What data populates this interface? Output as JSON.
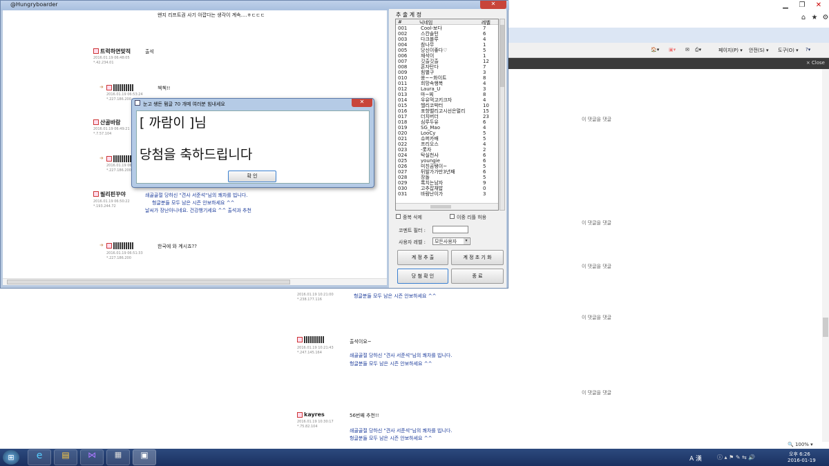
{
  "app": {
    "title": "@Hungryboarder",
    "close_label": "✕"
  },
  "content": {
    "top_text": "왠지 리프트권 사기 아깝다는 생각이 계속....ㅎㄷㄷㄷ",
    "comments": [
      {
        "user": "트럭하면맞적",
        "meta1": "2016.01.19 06:48:05",
        "meta2": "*.42.234.01",
        "text": "출석"
      },
      {
        "user": "",
        "meta1": "2016.01.19 06:53:24",
        "meta2": "*.227.186.200",
        "text": "첵첵!!"
      },
      {
        "user": "산골바람",
        "meta1": "2016.01.19 06:49:21",
        "meta2": "*.7.57.104",
        "text": ""
      },
      {
        "user": "",
        "meta1": "2016.01.19 06:",
        "meta2": "*.227.186.200",
        "text": ""
      },
      {
        "user": "필리핀꾸야",
        "meta1": "2016.01.19 06:50:22",
        "meta2": "*.193.244.72",
        "text": "쇄골골절 당하신 \"견사 서준석\"님의 쾌차를 빕니다.",
        "text2": "헝글분들 모두 남은 시즌 안보하세요 ^^",
        "text3": "날씨가 장난아니네요. 건강챙기세요  ^^ 출석과 추천"
      },
      {
        "user": "",
        "meta1": "2016.01.19 06:51:33",
        "meta2": "*.227.186.200",
        "text": "한국에 와 계시죠??"
      }
    ]
  },
  "panel": {
    "title": "추 출 계 정",
    "headers": [
      "#",
      "닉네임",
      "레벨"
    ],
    "rows": [
      [
        "001",
        "Cool-보다",
        "7"
      ],
      [
        "002",
        "스칸솔턴",
        "6"
      ],
      [
        "003",
        "다크블루",
        "4"
      ],
      [
        "004",
        "참나무",
        "1"
      ],
      [
        "005",
        "당신이좋다♡",
        "5"
      ],
      [
        "006",
        "재석이",
        "1"
      ],
      [
        "007",
        "깃츨깃츨",
        "12"
      ],
      [
        "008",
        "혼자탄다",
        "7"
      ],
      [
        "009",
        "힘별구",
        "3"
      ],
      [
        "010",
        "쏭~~화이트",
        "8"
      ],
      [
        "011",
        "희망속행복",
        "4"
      ],
      [
        "012",
        "Laura_U",
        "3"
      ],
      [
        "013",
        "마~찌",
        "8"
      ],
      [
        "014",
        "우유먹고키크자",
        "4"
      ],
      [
        "015",
        "헬리코박터",
        "10"
      ],
      [
        "016",
        "포항벨리고시선은멀리",
        "15"
      ],
      [
        "017",
        "더치버더",
        "23"
      ],
      [
        "018",
        "심루두유",
        "6"
      ],
      [
        "019",
        "SG_Mao",
        "4"
      ],
      [
        "020",
        "LooCy",
        "5"
      ],
      [
        "021",
        "슈퍼카배",
        "5"
      ],
      [
        "022",
        "프리오스",
        "4"
      ],
      [
        "023",
        "-롯자",
        "2"
      ],
      [
        "024",
        "탁실천사",
        "6"
      ],
      [
        "025",
        "youngie",
        "6"
      ],
      [
        "026",
        "미친곰탱이~",
        "5"
      ],
      [
        "027",
        "뒤발가가만3년째",
        "6"
      ],
      [
        "028",
        "장돌",
        "5"
      ],
      [
        "029",
        "록치는남자",
        "9"
      ],
      [
        "030",
        "고추잡채밥",
        "0"
      ],
      [
        "031",
        "바람난이가",
        "3"
      ]
    ],
    "chk_dup": "중복 삭제",
    "chk_double": "이중 리플 허용",
    "filter_label": "코멘트 필터 :",
    "filter_value": "",
    "level_label": "사용자 레벨 :",
    "level_value": "모든사용자",
    "btn_extract": "계 정 추 출",
    "btn_reset": "계 정 초 기 화",
    "btn_confirm": "당 첨 확 인",
    "btn_exit": "종 료"
  },
  "dialog": {
    "title": "눈고 쌩돈 펌글 70 개떼 여러분 힘내세요",
    "line1": "[ 까람이 ]님",
    "line2": "당첨을 축하드립니다",
    "ok": "확 인"
  },
  "browser": {
    "menu_page": "페이지(P) ▾",
    "menu_safety": "안전(S) ▾",
    "menu_tools": "도구(O) ▾",
    "close_notice": "× Close",
    "zoom": "🔍 100%  ▾"
  },
  "page": {
    "reply_link": "이 댓글을  댓글",
    "lower_comments": [
      {
        "meta1": "2016.01.19 10:21:00",
        "meta2": "*.238.177.116",
        "text": "헝글분들 모두 남은 시즌 안보하세요 ^^"
      },
      {
        "user": "",
        "meta1": "2016.01.19 10:21:43",
        "meta2": "*.247.145.164",
        "text": "출석이요~",
        "text2": "쇄골골절 당하신 \"견사 서준석\"님의 쾌차를 빕니다.",
        "text3": "헝글분들 모두 남은 시즌 안보하세요 ^^"
      },
      {
        "user": "kayres",
        "meta1": "2016.01.19 10:30:17",
        "meta2": "*.75.82.104",
        "text": "56번째 추천!!",
        "text2": "쇄골골절 당하신 \"견사 서준석\"님의 쾌차를 빕니다.",
        "text3": "헝글분들 모두 남은 시즌 안보하세요 ^^"
      }
    ]
  },
  "taskbar": {
    "time": "오후 6:26",
    "date": "2016-01-19",
    "ime": "A 漢"
  }
}
